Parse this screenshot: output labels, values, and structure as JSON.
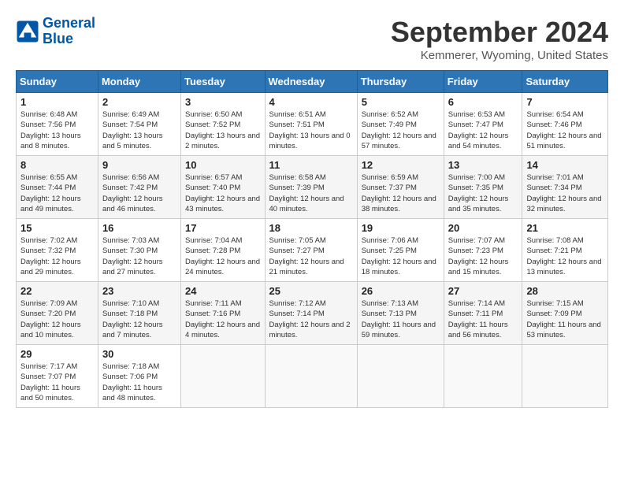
{
  "header": {
    "logo_line1": "General",
    "logo_line2": "Blue",
    "month_title": "September 2024",
    "location": "Kemmerer, Wyoming, United States"
  },
  "days_of_week": [
    "Sunday",
    "Monday",
    "Tuesday",
    "Wednesday",
    "Thursday",
    "Friday",
    "Saturday"
  ],
  "weeks": [
    [
      {
        "day": "1",
        "sunrise": "Sunrise: 6:48 AM",
        "sunset": "Sunset: 7:56 PM",
        "daylight": "Daylight: 13 hours and 8 minutes."
      },
      {
        "day": "2",
        "sunrise": "Sunrise: 6:49 AM",
        "sunset": "Sunset: 7:54 PM",
        "daylight": "Daylight: 13 hours and 5 minutes."
      },
      {
        "day": "3",
        "sunrise": "Sunrise: 6:50 AM",
        "sunset": "Sunset: 7:52 PM",
        "daylight": "Daylight: 13 hours and 2 minutes."
      },
      {
        "day": "4",
        "sunrise": "Sunrise: 6:51 AM",
        "sunset": "Sunset: 7:51 PM",
        "daylight": "Daylight: 13 hours and 0 minutes."
      },
      {
        "day": "5",
        "sunrise": "Sunrise: 6:52 AM",
        "sunset": "Sunset: 7:49 PM",
        "daylight": "Daylight: 12 hours and 57 minutes."
      },
      {
        "day": "6",
        "sunrise": "Sunrise: 6:53 AM",
        "sunset": "Sunset: 7:47 PM",
        "daylight": "Daylight: 12 hours and 54 minutes."
      },
      {
        "day": "7",
        "sunrise": "Sunrise: 6:54 AM",
        "sunset": "Sunset: 7:46 PM",
        "daylight": "Daylight: 12 hours and 51 minutes."
      }
    ],
    [
      {
        "day": "8",
        "sunrise": "Sunrise: 6:55 AM",
        "sunset": "Sunset: 7:44 PM",
        "daylight": "Daylight: 12 hours and 49 minutes."
      },
      {
        "day": "9",
        "sunrise": "Sunrise: 6:56 AM",
        "sunset": "Sunset: 7:42 PM",
        "daylight": "Daylight: 12 hours and 46 minutes."
      },
      {
        "day": "10",
        "sunrise": "Sunrise: 6:57 AM",
        "sunset": "Sunset: 7:40 PM",
        "daylight": "Daylight: 12 hours and 43 minutes."
      },
      {
        "day": "11",
        "sunrise": "Sunrise: 6:58 AM",
        "sunset": "Sunset: 7:39 PM",
        "daylight": "Daylight: 12 hours and 40 minutes."
      },
      {
        "day": "12",
        "sunrise": "Sunrise: 6:59 AM",
        "sunset": "Sunset: 7:37 PM",
        "daylight": "Daylight: 12 hours and 38 minutes."
      },
      {
        "day": "13",
        "sunrise": "Sunrise: 7:00 AM",
        "sunset": "Sunset: 7:35 PM",
        "daylight": "Daylight: 12 hours and 35 minutes."
      },
      {
        "day": "14",
        "sunrise": "Sunrise: 7:01 AM",
        "sunset": "Sunset: 7:34 PM",
        "daylight": "Daylight: 12 hours and 32 minutes."
      }
    ],
    [
      {
        "day": "15",
        "sunrise": "Sunrise: 7:02 AM",
        "sunset": "Sunset: 7:32 PM",
        "daylight": "Daylight: 12 hours and 29 minutes."
      },
      {
        "day": "16",
        "sunrise": "Sunrise: 7:03 AM",
        "sunset": "Sunset: 7:30 PM",
        "daylight": "Daylight: 12 hours and 27 minutes."
      },
      {
        "day": "17",
        "sunrise": "Sunrise: 7:04 AM",
        "sunset": "Sunset: 7:28 PM",
        "daylight": "Daylight: 12 hours and 24 minutes."
      },
      {
        "day": "18",
        "sunrise": "Sunrise: 7:05 AM",
        "sunset": "Sunset: 7:27 PM",
        "daylight": "Daylight: 12 hours and 21 minutes."
      },
      {
        "day": "19",
        "sunrise": "Sunrise: 7:06 AM",
        "sunset": "Sunset: 7:25 PM",
        "daylight": "Daylight: 12 hours and 18 minutes."
      },
      {
        "day": "20",
        "sunrise": "Sunrise: 7:07 AM",
        "sunset": "Sunset: 7:23 PM",
        "daylight": "Daylight: 12 hours and 15 minutes."
      },
      {
        "day": "21",
        "sunrise": "Sunrise: 7:08 AM",
        "sunset": "Sunset: 7:21 PM",
        "daylight": "Daylight: 12 hours and 13 minutes."
      }
    ],
    [
      {
        "day": "22",
        "sunrise": "Sunrise: 7:09 AM",
        "sunset": "Sunset: 7:20 PM",
        "daylight": "Daylight: 12 hours and 10 minutes."
      },
      {
        "day": "23",
        "sunrise": "Sunrise: 7:10 AM",
        "sunset": "Sunset: 7:18 PM",
        "daylight": "Daylight: 12 hours and 7 minutes."
      },
      {
        "day": "24",
        "sunrise": "Sunrise: 7:11 AM",
        "sunset": "Sunset: 7:16 PM",
        "daylight": "Daylight: 12 hours and 4 minutes."
      },
      {
        "day": "25",
        "sunrise": "Sunrise: 7:12 AM",
        "sunset": "Sunset: 7:14 PM",
        "daylight": "Daylight: 12 hours and 2 minutes."
      },
      {
        "day": "26",
        "sunrise": "Sunrise: 7:13 AM",
        "sunset": "Sunset: 7:13 PM",
        "daylight": "Daylight: 11 hours and 59 minutes."
      },
      {
        "day": "27",
        "sunrise": "Sunrise: 7:14 AM",
        "sunset": "Sunset: 7:11 PM",
        "daylight": "Daylight: 11 hours and 56 minutes."
      },
      {
        "day": "28",
        "sunrise": "Sunrise: 7:15 AM",
        "sunset": "Sunset: 7:09 PM",
        "daylight": "Daylight: 11 hours and 53 minutes."
      }
    ],
    [
      {
        "day": "29",
        "sunrise": "Sunrise: 7:17 AM",
        "sunset": "Sunset: 7:07 PM",
        "daylight": "Daylight: 11 hours and 50 minutes."
      },
      {
        "day": "30",
        "sunrise": "Sunrise: 7:18 AM",
        "sunset": "Sunset: 7:06 PM",
        "daylight": "Daylight: 11 hours and 48 minutes."
      },
      {
        "day": "",
        "sunrise": "",
        "sunset": "",
        "daylight": ""
      },
      {
        "day": "",
        "sunrise": "",
        "sunset": "",
        "daylight": ""
      },
      {
        "day": "",
        "sunrise": "",
        "sunset": "",
        "daylight": ""
      },
      {
        "day": "",
        "sunrise": "",
        "sunset": "",
        "daylight": ""
      },
      {
        "day": "",
        "sunrise": "",
        "sunset": "",
        "daylight": ""
      }
    ]
  ]
}
